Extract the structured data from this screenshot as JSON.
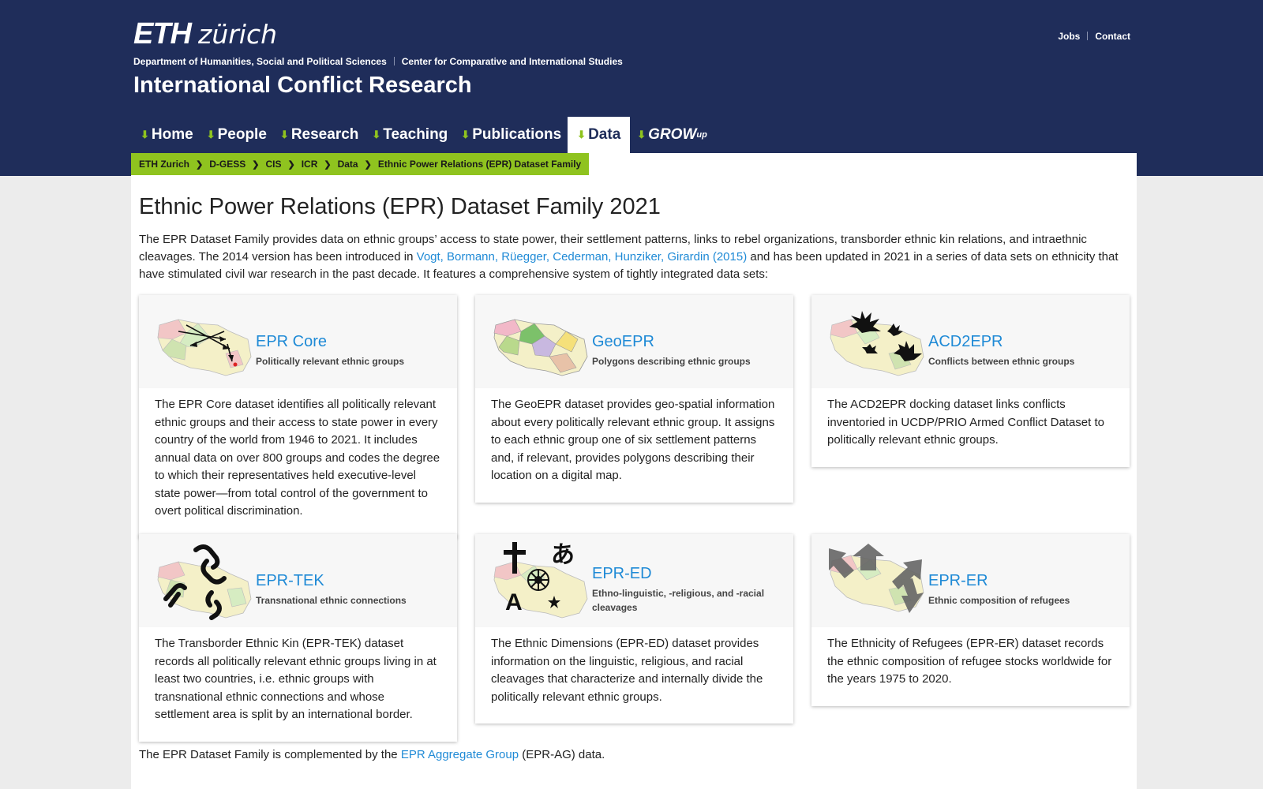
{
  "header": {
    "logo_eth": "ETH",
    "logo_zurich": "zürich",
    "dept_links": [
      "Department of Humanities, Social and Political Sciences",
      "Center for Comparative and International Studies"
    ],
    "site_title": "International Conflict Research",
    "meta_nav": [
      "Jobs",
      "Contact"
    ]
  },
  "nav": {
    "items": [
      {
        "label": "Home"
      },
      {
        "label": "People"
      },
      {
        "label": "Research"
      },
      {
        "label": "Teaching"
      },
      {
        "label": "Publications"
      },
      {
        "label": "Data"
      },
      {
        "label": "GROW",
        "sup": "up"
      }
    ],
    "active": "Data"
  },
  "breadcrumb": [
    "ETH Zurich",
    "D-GESS",
    "CIS",
    "ICR",
    "Data",
    "Ethnic Power Relations (EPR) Dataset Family"
  ],
  "page": {
    "title": "Ethnic Power Relations (EPR) Dataset Family 2021",
    "intro_1": "The EPR Dataset Family provides data on ethnic groups’ access to state power, their settlement patterns, links to rebel organizations, transborder ethnic kin relations, and intraethnic cleavages. The 2014 version has been introduced in ",
    "intro_link": "Vogt, Bormann, Rüegger, Cederman, Hunziker, Girardin (2015)",
    "intro_2": " and has been updated in 2021 in a series of data sets on ethnicity that have stimulated civil war research in the past decade. It features a comprehensive system of tightly integrated data sets:"
  },
  "cards": [
    {
      "name": "EPR Core",
      "subtitle": "Politically relevant ethnic groups",
      "icon": "arrows-map-icon",
      "text": "The EPR Core dataset identifies all politically relevant ethnic groups and their access to state power in every country of the world from 1946 to 2021. It includes annual data on over 800 groups and codes the degree to which their representatives held executive-level state power—from total control of the government to overt political discrimination."
    },
    {
      "name": "GeoEPR",
      "subtitle": "Polygons describing ethnic groups",
      "icon": "polygon-map-icon",
      "text": "The GeoEPR dataset provides geo-spatial information about every politically relevant ethnic group. It assigns to each ethnic group one of six settlement patterns and, if relevant, provides polygons describing their location on a digital map."
    },
    {
      "name": "ACD2EPR",
      "subtitle": "Conflicts between ethnic groups",
      "icon": "explosion-map-icon",
      "text": "The ACD2EPR docking dataset links conflicts inventoried in UCDP/PRIO Armed Conflict Dataset to politically relevant ethnic groups."
    },
    {
      "name": "EPR-TEK",
      "subtitle": "Transnational ethnic connections",
      "icon": "chain-map-icon",
      "text": "The Transborder Ethnic Kin (EPR-TEK) dataset records all politically relevant ethnic groups living in at least two countries, i.e. ethnic groups with transnational ethnic connections and whose settlement area is split by an international border."
    },
    {
      "name": "EPR-ED",
      "subtitle": "Ethno-linguistic, -religious, and -racial cleavages",
      "icon": "symbols-map-icon",
      "text": "The Ethnic Dimensions (EPR-ED) dataset provides information on the linguistic, religious, and racial cleavages that characterize and internally divide the politically relevant ethnic groups."
    },
    {
      "name": "EPR-ER",
      "subtitle": "Ethnic composition of refugees",
      "icon": "refugee-arrows-map-icon",
      "text": "The Ethnicity of Refugees (EPR-ER) dataset records the ethnic composition of refugee stocks worldwide for the years 1975 to 2020."
    }
  ],
  "footer": {
    "text_1": "The EPR Dataset Family is complemented by the ",
    "link": "EPR Aggregate Group",
    "text_2": " (EPR-AG) data."
  }
}
